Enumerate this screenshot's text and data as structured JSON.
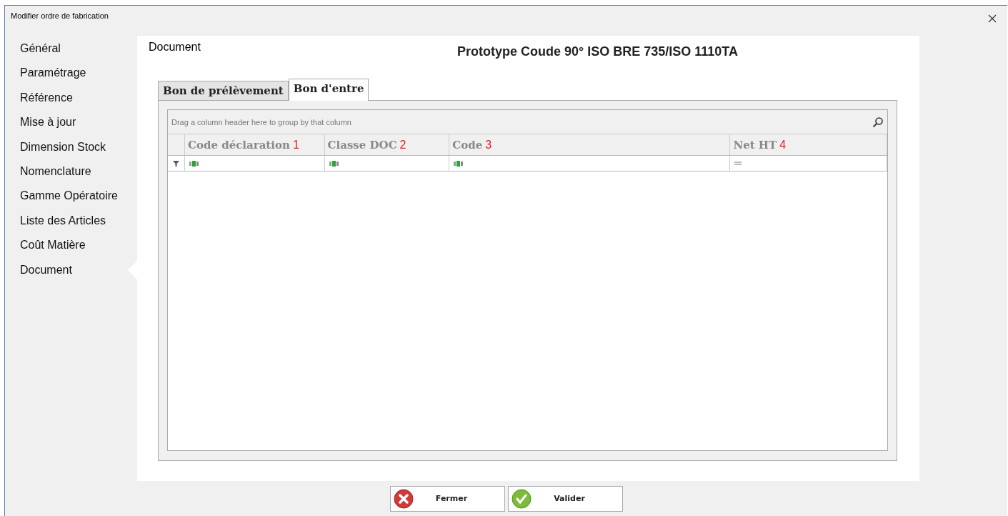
{
  "window": {
    "title": "Modifier ordre de fabrication"
  },
  "sidebar": {
    "items": [
      {
        "label": "Général",
        "selected": false
      },
      {
        "label": "Paramétrage",
        "selected": false
      },
      {
        "label": "Référence",
        "selected": false
      },
      {
        "label": "Mise à jour",
        "selected": false
      },
      {
        "label": "Dimension Stock",
        "selected": false
      },
      {
        "label": "Nomenclature",
        "selected": false
      },
      {
        "label": "Gamme Opératoire",
        "selected": false
      },
      {
        "label": "Liste des Articles",
        "selected": false
      },
      {
        "label": "Coût Matière",
        "selected": false
      },
      {
        "label": "Document",
        "selected": true
      }
    ]
  },
  "section_title": "Document",
  "product_title": "Prototype Coude 90° ISO BRE 735/ISO 1110TA",
  "tabs": [
    {
      "label": "Bon de prélèvement",
      "selected": false
    },
    {
      "label": "Bon d'entre",
      "selected": true
    }
  ],
  "grid": {
    "group_panel": "Drag a column header here to group by that column",
    "columns": [
      {
        "label": "Code déclaration",
        "marker": "1",
        "kind": "text"
      },
      {
        "label": "Classe DOC",
        "marker": "2",
        "kind": "text"
      },
      {
        "label": "Code",
        "marker": "3",
        "kind": "text"
      },
      {
        "label": "Net HT",
        "marker": "4",
        "kind": "number"
      }
    ]
  },
  "buttons": [
    {
      "label": "Fermer",
      "kind": "cancel"
    },
    {
      "label": "Valider",
      "kind": "ok"
    }
  ]
}
